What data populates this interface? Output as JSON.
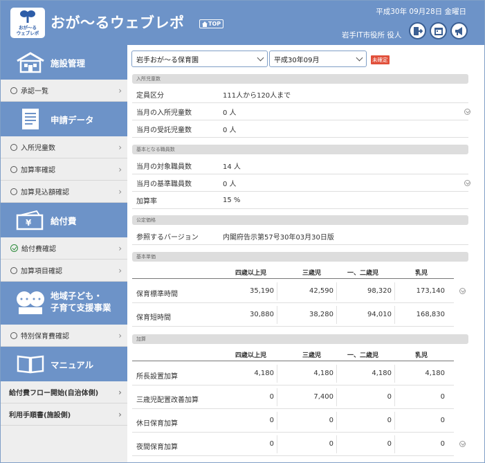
{
  "header": {
    "logo_text_line1": "おが～る",
    "logo_text_line2": "ウェブレポ",
    "title": "おが～るウェブレポ",
    "top_badge": "TOP",
    "date": "平成30年 09月28日 金曜日",
    "user": "岩手IT市役所 役人"
  },
  "sidebar": {
    "sections": [
      {
        "label": "施設管理",
        "icon": "building-icon",
        "items": [
          {
            "label": "承認一覧",
            "state": "radio"
          }
        ]
      },
      {
        "label": "申請データ",
        "icon": "document-icon",
        "items": [
          {
            "label": "入所児童数",
            "state": "radio"
          },
          {
            "label": "加算率確認",
            "state": "radio"
          },
          {
            "label": "加算見込額確認",
            "state": "radio"
          }
        ]
      },
      {
        "label": "給付費",
        "icon": "money-icon",
        "items": [
          {
            "label": "給付費確認",
            "state": "checked"
          },
          {
            "label": "加算項目確認",
            "state": "radio"
          }
        ]
      },
      {
        "label_line1": "地域子ども・",
        "label_line2": "子育て支援事業",
        "icon": "children-icon",
        "items": [
          {
            "label": "特別保育費確認",
            "state": "radio"
          }
        ]
      },
      {
        "label": "マニュアル",
        "icon": "book-icon",
        "items": [
          {
            "label": "給付費フロー開始(自治体側)"
          },
          {
            "label": "利用手順書(施設側)"
          }
        ]
      }
    ]
  },
  "main": {
    "facility_select": "岩手おが～る保育園",
    "month_select": "平成30年09月",
    "status_badge": "未確定",
    "enrollment": {
      "heading": "入所児童数",
      "rows": [
        {
          "label": "定員区分",
          "value": "111人から120人まで"
        },
        {
          "label": "当月の入所児童数",
          "value": "0 人"
        },
        {
          "label": "当月の受託児童数",
          "value": "0 人"
        }
      ]
    },
    "staff": {
      "heading": "基本となる職員数",
      "rows": [
        {
          "label": "当月の対象職員数",
          "value": "14 人"
        },
        {
          "label": "当月の基準職員数",
          "value": "0 人"
        },
        {
          "label": "加算率",
          "value": "15 %"
        }
      ]
    },
    "price": {
      "heading": "公定価格",
      "rows": [
        {
          "label": "参照するバージョン",
          "value": "内閣府告示第57号30年03月30日版"
        }
      ]
    },
    "unit_price": {
      "heading": "基本単価",
      "columns": [
        "四歳以上児",
        "三歳児",
        "一、二歳児",
        "乳児"
      ],
      "rows": [
        {
          "label": "保育標準時間",
          "values": [
            "35,190",
            "42,590",
            "98,320",
            "173,140"
          ]
        },
        {
          "label": "保育短時間",
          "values": [
            "30,880",
            "38,280",
            "94,010",
            "168,830"
          ]
        }
      ]
    },
    "additions": {
      "heading": "加算",
      "columns": [
        "四歳以上児",
        "三歳児",
        "一、二歳児",
        "乳児"
      ],
      "rows": [
        {
          "label": "所長設置加算",
          "values": [
            "4,180",
            "4,180",
            "4,180",
            "4,180"
          ]
        },
        {
          "label": "三歳児配置改善加算",
          "values": [
            "0",
            "7,400",
            "0",
            "0"
          ]
        },
        {
          "label": "休日保育加算",
          "values": [
            "0",
            "0",
            "0",
            "0"
          ]
        },
        {
          "label": "夜間保育加算",
          "values": [
            "0",
            "0",
            "0",
            "0"
          ]
        }
      ]
    }
  }
}
